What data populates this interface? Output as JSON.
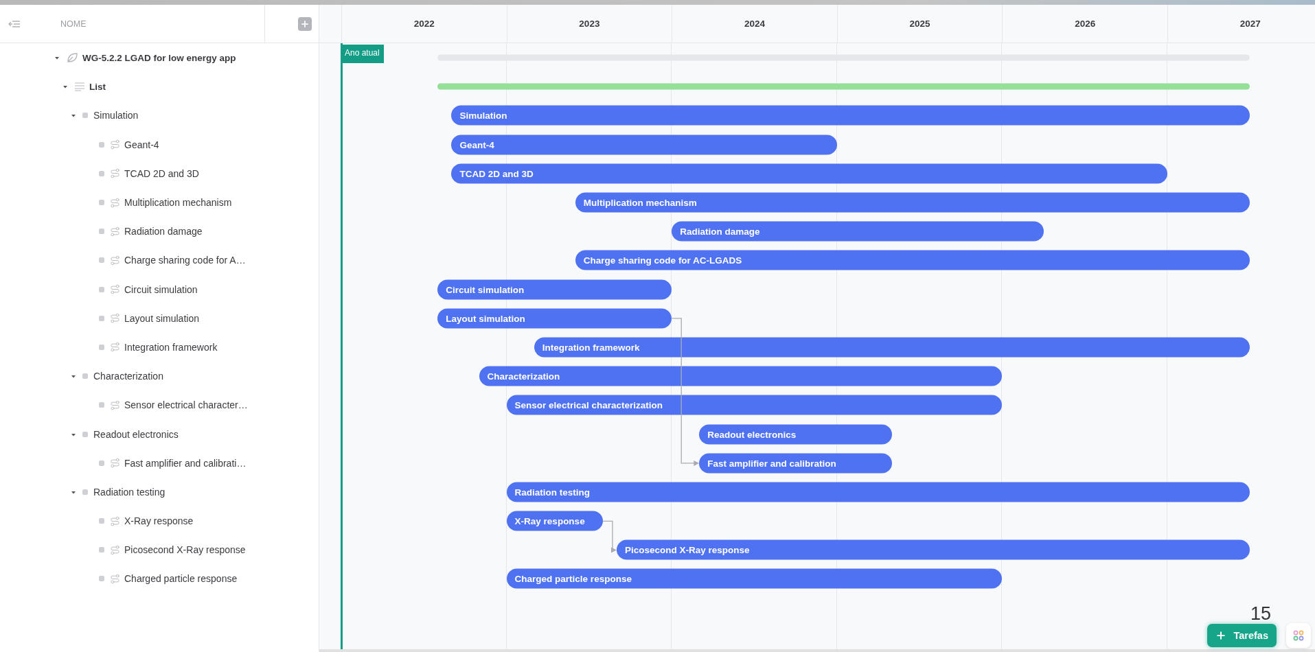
{
  "header": {
    "name_column": "NOME"
  },
  "tree": [
    {
      "label": "WG-5.2.2 LGAD for low energy app",
      "kind": "project",
      "expanded": true,
      "children": [
        {
          "label": "List",
          "kind": "list",
          "expanded": true,
          "children": [
            {
              "label": "Simulation",
              "kind": "group",
              "expanded": true,
              "children": [
                {
                  "label": "Geant-4",
                  "kind": "task"
                },
                {
                  "label": "TCAD 2D and 3D",
                  "kind": "task"
                },
                {
                  "label": "Multiplication mechanism",
                  "kind": "task"
                },
                {
                  "label": "Radiation damage",
                  "kind": "task"
                },
                {
                  "label": "Charge sharing code for A…",
                  "kind": "task"
                },
                {
                  "label": "Circuit simulation",
                  "kind": "task"
                },
                {
                  "label": "Layout simulation",
                  "kind": "task"
                },
                {
                  "label": "Integration framework",
                  "kind": "task"
                }
              ]
            },
            {
              "label": "Characterization",
              "kind": "group",
              "expanded": true,
              "children": [
                {
                  "label": "Sensor electrical character…",
                  "kind": "task"
                }
              ]
            },
            {
              "label": "Readout electronics",
              "kind": "group",
              "expanded": true,
              "children": [
                {
                  "label": "Fast amplifier and calibrati…",
                  "kind": "task"
                }
              ]
            },
            {
              "label": "Radiation testing",
              "kind": "group",
              "expanded": true,
              "children": [
                {
                  "label": "X-Ray response",
                  "kind": "task"
                },
                {
                  "label": "Picosecond X-Ray response",
                  "kind": "task"
                },
                {
                  "label": "Charged particle response",
                  "kind": "task"
                }
              ]
            }
          ]
        }
      ]
    }
  ],
  "timeline": {
    "years": [
      "2022",
      "2023",
      "2024",
      "2025",
      "2026",
      "2027"
    ],
    "current_marker": "Ano atual",
    "bars": [
      {
        "kind": "summary"
      },
      {
        "kind": "progress",
        "level": 1
      },
      {
        "kind": "task",
        "label": "Simulation"
      },
      {
        "kind": "task",
        "label": "Geant-4"
      },
      {
        "kind": "task",
        "label": "TCAD 2D and 3D"
      },
      {
        "kind": "task",
        "label": "Multiplication mechanism"
      },
      {
        "kind": "task",
        "label": "Radiation damage"
      },
      {
        "kind": "task",
        "label": "Charge sharing code for AC-LGADS"
      },
      {
        "kind": "task",
        "label": "Circuit simulation"
      },
      {
        "kind": "task",
        "label": "Layout simulation"
      },
      {
        "kind": "task",
        "label": "Integration framework"
      },
      {
        "kind": "task",
        "label": "Characterization"
      },
      {
        "kind": "task",
        "label": "Sensor electrical characterization"
      },
      {
        "kind": "task",
        "label": "Readout electronics"
      },
      {
        "kind": "task",
        "label": "Fast amplifier and calibration"
      },
      {
        "kind": "task",
        "label": "Radiation testing"
      },
      {
        "kind": "task",
        "label": "X-Ray response"
      },
      {
        "kind": "task",
        "label": "Picosecond X-Ray response"
      },
      {
        "kind": "task",
        "label": "Charged particle response"
      }
    ]
  },
  "page_number": "15",
  "tasks_button": {
    "label": "Tarefas"
  }
}
